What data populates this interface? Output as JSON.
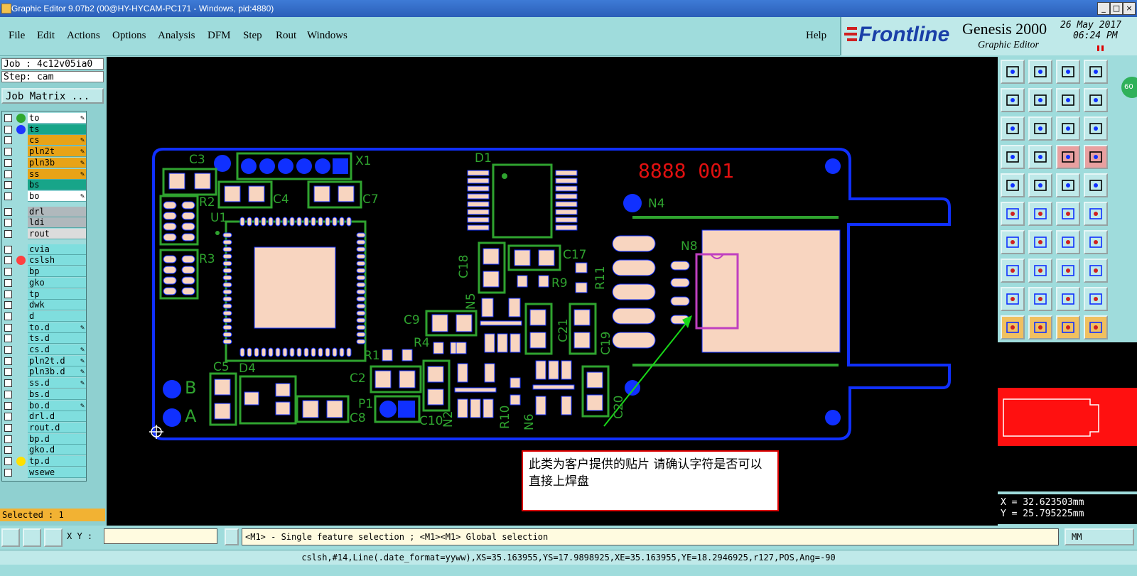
{
  "window": {
    "title": "Graphic Editor 9.07b2 (00@HY-HYCAM-PC171 - Windows, pid:4880)"
  },
  "menu": {
    "items": [
      "File",
      "Edit",
      "Actions",
      "Options",
      "Analysis",
      "DFM",
      "Step",
      "Rout",
      "Windows"
    ],
    "help": "Help"
  },
  "brand": {
    "logo": "Frontline",
    "product": "Genesis 2000",
    "subtitle": "Graphic Editor",
    "date": "26 May 2017",
    "time": "06:24 PM",
    "badge": "60"
  },
  "job": {
    "job_label": "Job : 4c12v05ia0",
    "step_label": "Step: cam",
    "matrix_button": "Job Matrix ..."
  },
  "layers": [
    {
      "name": "to",
      "bg": "#ffffff",
      "dot": "#2fa82f",
      "pen": true
    },
    {
      "name": "ts",
      "bg": "#17a589",
      "dot": "#1f35ff",
      "pen": false
    },
    {
      "name": "cs",
      "bg": "#e8a317",
      "dot": "",
      "pen": true
    },
    {
      "name": "pln2t",
      "bg": "#e8a317",
      "dot": "",
      "pen": true
    },
    {
      "name": "pln3b",
      "bg": "#e8a317",
      "dot": "",
      "pen": true
    },
    {
      "name": "ss",
      "bg": "#e8a317",
      "dot": "",
      "pen": true
    },
    {
      "name": "bs",
      "bg": "#17a589",
      "dot": "",
      "pen": false
    },
    {
      "name": "bo",
      "bg": "#ffffff",
      "dot": "",
      "pen": true
    },
    {
      "name": "drl",
      "bg": "#b0b8bc",
      "dot": "",
      "pen": false
    },
    {
      "name": "ldi",
      "bg": "#b0b8bc",
      "dot": "",
      "pen": false
    },
    {
      "name": "rout",
      "bg": "#dcdcdc",
      "dot": "",
      "pen": false
    },
    {
      "name": "cvia",
      "bg": "#7fdede",
      "dot": "",
      "pen": false
    },
    {
      "name": "cslsh",
      "bg": "#7fdede",
      "dot": "#ff4040",
      "pen": false
    },
    {
      "name": "bp",
      "bg": "#7fdede",
      "dot": "",
      "pen": false
    },
    {
      "name": "gko",
      "bg": "#7fdede",
      "dot": "",
      "pen": false
    },
    {
      "name": "tp",
      "bg": "#7fdede",
      "dot": "",
      "pen": false
    },
    {
      "name": "dwk",
      "bg": "#7fdede",
      "dot": "",
      "pen": false
    },
    {
      "name": "d",
      "bg": "#7fdede",
      "dot": "",
      "pen": false
    },
    {
      "name": "to.d",
      "bg": "#7fdede",
      "dot": "",
      "pen": true
    },
    {
      "name": "ts.d",
      "bg": "#7fdede",
      "dot": "",
      "pen": false
    },
    {
      "name": "cs.d",
      "bg": "#7fdede",
      "dot": "",
      "pen": true
    },
    {
      "name": "pln2t.d",
      "bg": "#7fdede",
      "dot": "",
      "pen": true
    },
    {
      "name": "pln3b.d",
      "bg": "#7fdede",
      "dot": "",
      "pen": true
    },
    {
      "name": "ss.d",
      "bg": "#7fdede",
      "dot": "",
      "pen": true
    },
    {
      "name": "bs.d",
      "bg": "#7fdede",
      "dot": "",
      "pen": false
    },
    {
      "name": "bo.d",
      "bg": "#7fdede",
      "dot": "",
      "pen": true
    },
    {
      "name": "drl.d",
      "bg": "#7fdede",
      "dot": "",
      "pen": false
    },
    {
      "name": "rout.d",
      "bg": "#7fdede",
      "dot": "",
      "pen": false
    },
    {
      "name": "bp.d",
      "bg": "#7fdede",
      "dot": "",
      "pen": false
    },
    {
      "name": "gko.d",
      "bg": "#7fdede",
      "dot": "",
      "pen": false
    },
    {
      "name": "tp.d",
      "bg": "#7fdede",
      "dot": "#ffe000",
      "pen": false
    },
    {
      "name": "wsewe",
      "bg": "#7fdede",
      "dot": "",
      "pen": false
    }
  ],
  "selected": "Selected : 1",
  "pcb": {
    "refdes": [
      "C3",
      "X1",
      "D1",
      "R2",
      "C4",
      "C7",
      "U1",
      "R3",
      "N4",
      "N8",
      "C18",
      "C17",
      "R9",
      "R11",
      "N5",
      "C9",
      "R4",
      "C21",
      "C19",
      "R1",
      "C2",
      "C5",
      "D4",
      "B",
      "A",
      "P1",
      "C8",
      "C10",
      "N2",
      "R10",
      "N6",
      "C20"
    ],
    "serial": "8888 001"
  },
  "note": {
    "text": "此类为客户提供的贴片 请确认字符是否可以直接上焊盘"
  },
  "coords": {
    "x": "X = 32.623503mm",
    "y": "Y = 25.795225mm"
  },
  "bottom": {
    "xy_label": "X Y :",
    "xy_value": "",
    "prompt": "<M1> - Single feature selection ; <M1><M1> Global selection",
    "units": "MM"
  },
  "status": "cslsh,#14,Line(.date_format=yyww),XS=35.163955,YS=17.9898925,XE=35.163955,YE=18.2946925,r127,POS,Ang=-90",
  "colors": {
    "board_outline": "#1030ff",
    "silkscreen": "#2fa32f",
    "pad": "#f8d5c0",
    "serial": "#e01010",
    "note_border": "#dd0000",
    "arrow": "#18d818"
  }
}
